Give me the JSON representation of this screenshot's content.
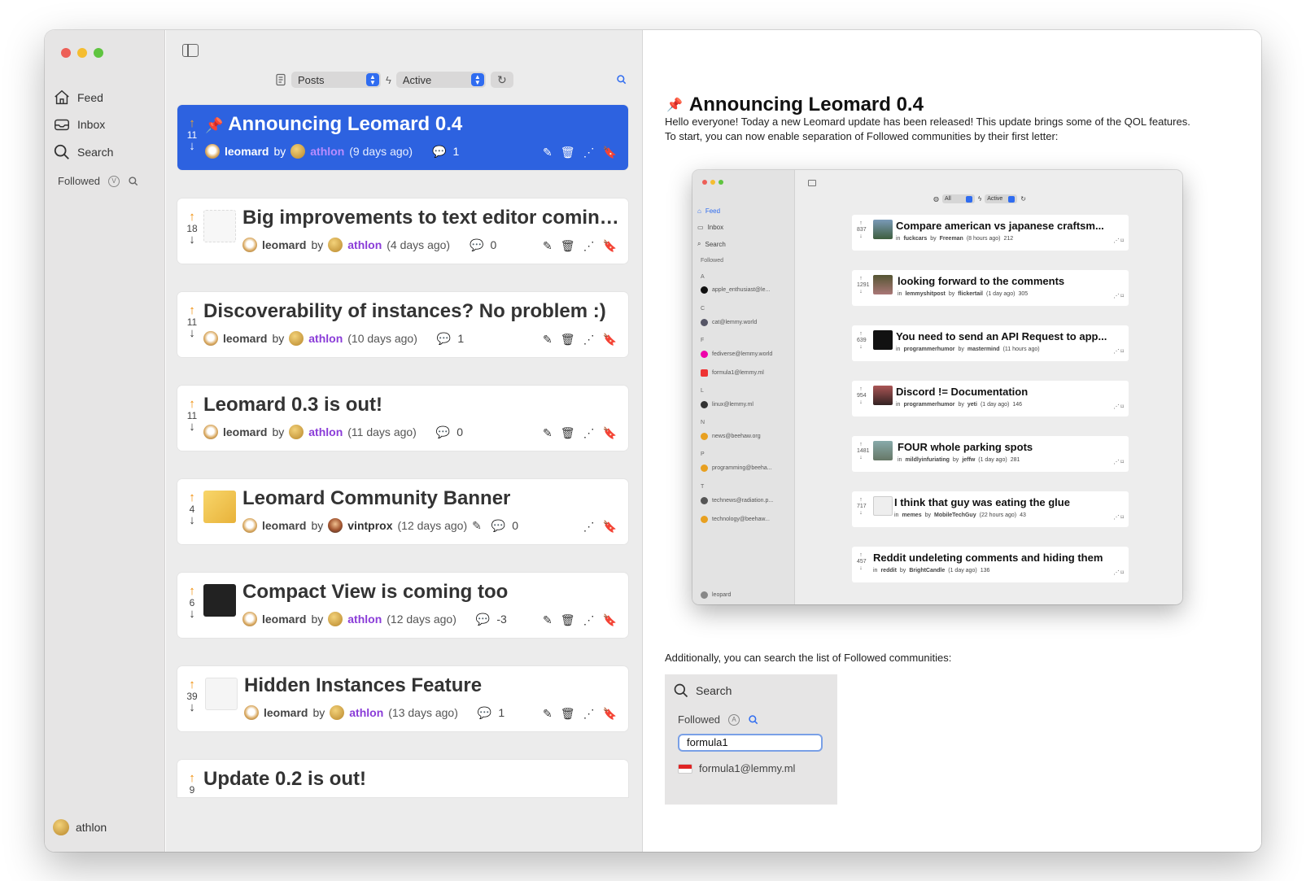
{
  "sidebar": {
    "items": [
      {
        "label": "Feed",
        "icon": "house-icon"
      },
      {
        "label": "Inbox",
        "icon": "tray-icon"
      },
      {
        "label": "Search",
        "icon": "magnifier-icon"
      }
    ],
    "followed_label": "Followed",
    "user": "athlon"
  },
  "toolbar": {
    "sort_value": "Posts",
    "filter_value": "Active"
  },
  "posts": [
    {
      "score": "11",
      "title": "Announcing Leomard 0.4",
      "author": "leomard",
      "by": "by",
      "creator": "athlon",
      "time": "(9 days ago)",
      "comments": "1",
      "pinned": true
    },
    {
      "score": "18",
      "title": "Big improvements to text editor coming s...",
      "author": "leomard",
      "by": "by",
      "creator": "athlon",
      "time": "(4 days ago)",
      "comments": "0"
    },
    {
      "score": "11",
      "title": "Discoverability of instances? No problem :)",
      "author": "leomard",
      "by": "by",
      "creator": "athlon",
      "time": "(10 days ago)",
      "comments": "1"
    },
    {
      "score": "11",
      "title": "Leomard 0.3 is out!",
      "author": "leomard",
      "by": "by",
      "creator": "athlon",
      "time": "(11 days ago)",
      "comments": "0"
    },
    {
      "score": "4",
      "title": "Leomard Community Banner",
      "author": "leomard",
      "by": "by",
      "creator": "vintprox",
      "time": "(12 days ago)",
      "comments": "0"
    },
    {
      "score": "6",
      "title": "Compact View is coming too",
      "author": "leomard",
      "by": "by",
      "creator": "athlon",
      "time": "(12 days ago)",
      "comments": "-3"
    },
    {
      "score": "39",
      "title": "Hidden Instances Feature",
      "author": "leomard",
      "by": "by",
      "creator": "athlon",
      "time": "(13 days ago)",
      "comments": "1"
    },
    {
      "score": "9",
      "title": "Update 0.2 is out!"
    }
  ],
  "detail": {
    "title": "Announcing Leomard 0.4",
    "body1": "Hello everyone! Today a new Leomard update has been released! This update brings some of the QOL features.",
    "body2": "To start, you can now enable separation of Followed communities by their first letter:",
    "body3": "Additionally, you can search the list of Followed communities:"
  },
  "embedded": {
    "nav": [
      "Feed",
      "Inbox",
      "Search"
    ],
    "followed": "Followed",
    "letters": [
      "A",
      "C",
      "F",
      "L",
      "N",
      "P",
      "T"
    ],
    "communities": [
      "apple_enthusiast@le...",
      "cat@lemmy.world",
      "fediverse@lemmy.world",
      "formula1@lemmy.ml",
      "linux@lemmy.ml",
      "news@beehaw.org",
      "programming@beeha...",
      "technews@radiation.p...",
      "technology@beehaw..."
    ],
    "user": "leopard",
    "sort": "All",
    "filter": "Active",
    "posts": [
      {
        "score": "837",
        "title": "Compare american vs japanese craftsm...",
        "in": "in",
        "community": "fuckcars",
        "by": "by",
        "creator": "Freeman",
        "time": "(8 hours ago)",
        "comments": "212"
      },
      {
        "score": "1291",
        "title": "looking forward to the comments",
        "in": "in",
        "community": "lemmyshitpost",
        "by": "by",
        "creator": "flickertail",
        "time": "(1 day ago)",
        "comments": "305"
      },
      {
        "score": "639",
        "title": "You need to send an API Request to app...",
        "in": "in",
        "community": "programmerhumor",
        "by": "by",
        "creator": "mastermind",
        "time": "(11 hours ago)",
        "comments": ""
      },
      {
        "score": "954",
        "title": "Discord != Documentation",
        "in": "in",
        "community": "programmerhumor",
        "by": "by",
        "creator": "yeti",
        "time": "(1 day ago)",
        "comments": "146"
      },
      {
        "score": "1481",
        "title": "FOUR whole parking spots",
        "in": "in",
        "community": "mildlyinfuriating",
        "by": "by",
        "creator": "jeffw",
        "time": "(1 day ago)",
        "comments": "281"
      },
      {
        "score": "717",
        "title": "I think that guy was eating the glue",
        "in": "in",
        "community": "memes",
        "by": "by",
        "creator": "MobileTechGuy",
        "time": "(22 hours ago)",
        "comments": "43"
      },
      {
        "score": "457",
        "title": "Reddit undeleting comments and hiding them",
        "in": "in",
        "community": "reddit",
        "by": "by",
        "creator": "BrightCandle",
        "time": "(1 day ago)",
        "comments": "136"
      }
    ]
  },
  "snippet": {
    "search": "Search",
    "followed": "Followed",
    "input_value": "formula1",
    "result": "formula1@lemmy.ml"
  }
}
